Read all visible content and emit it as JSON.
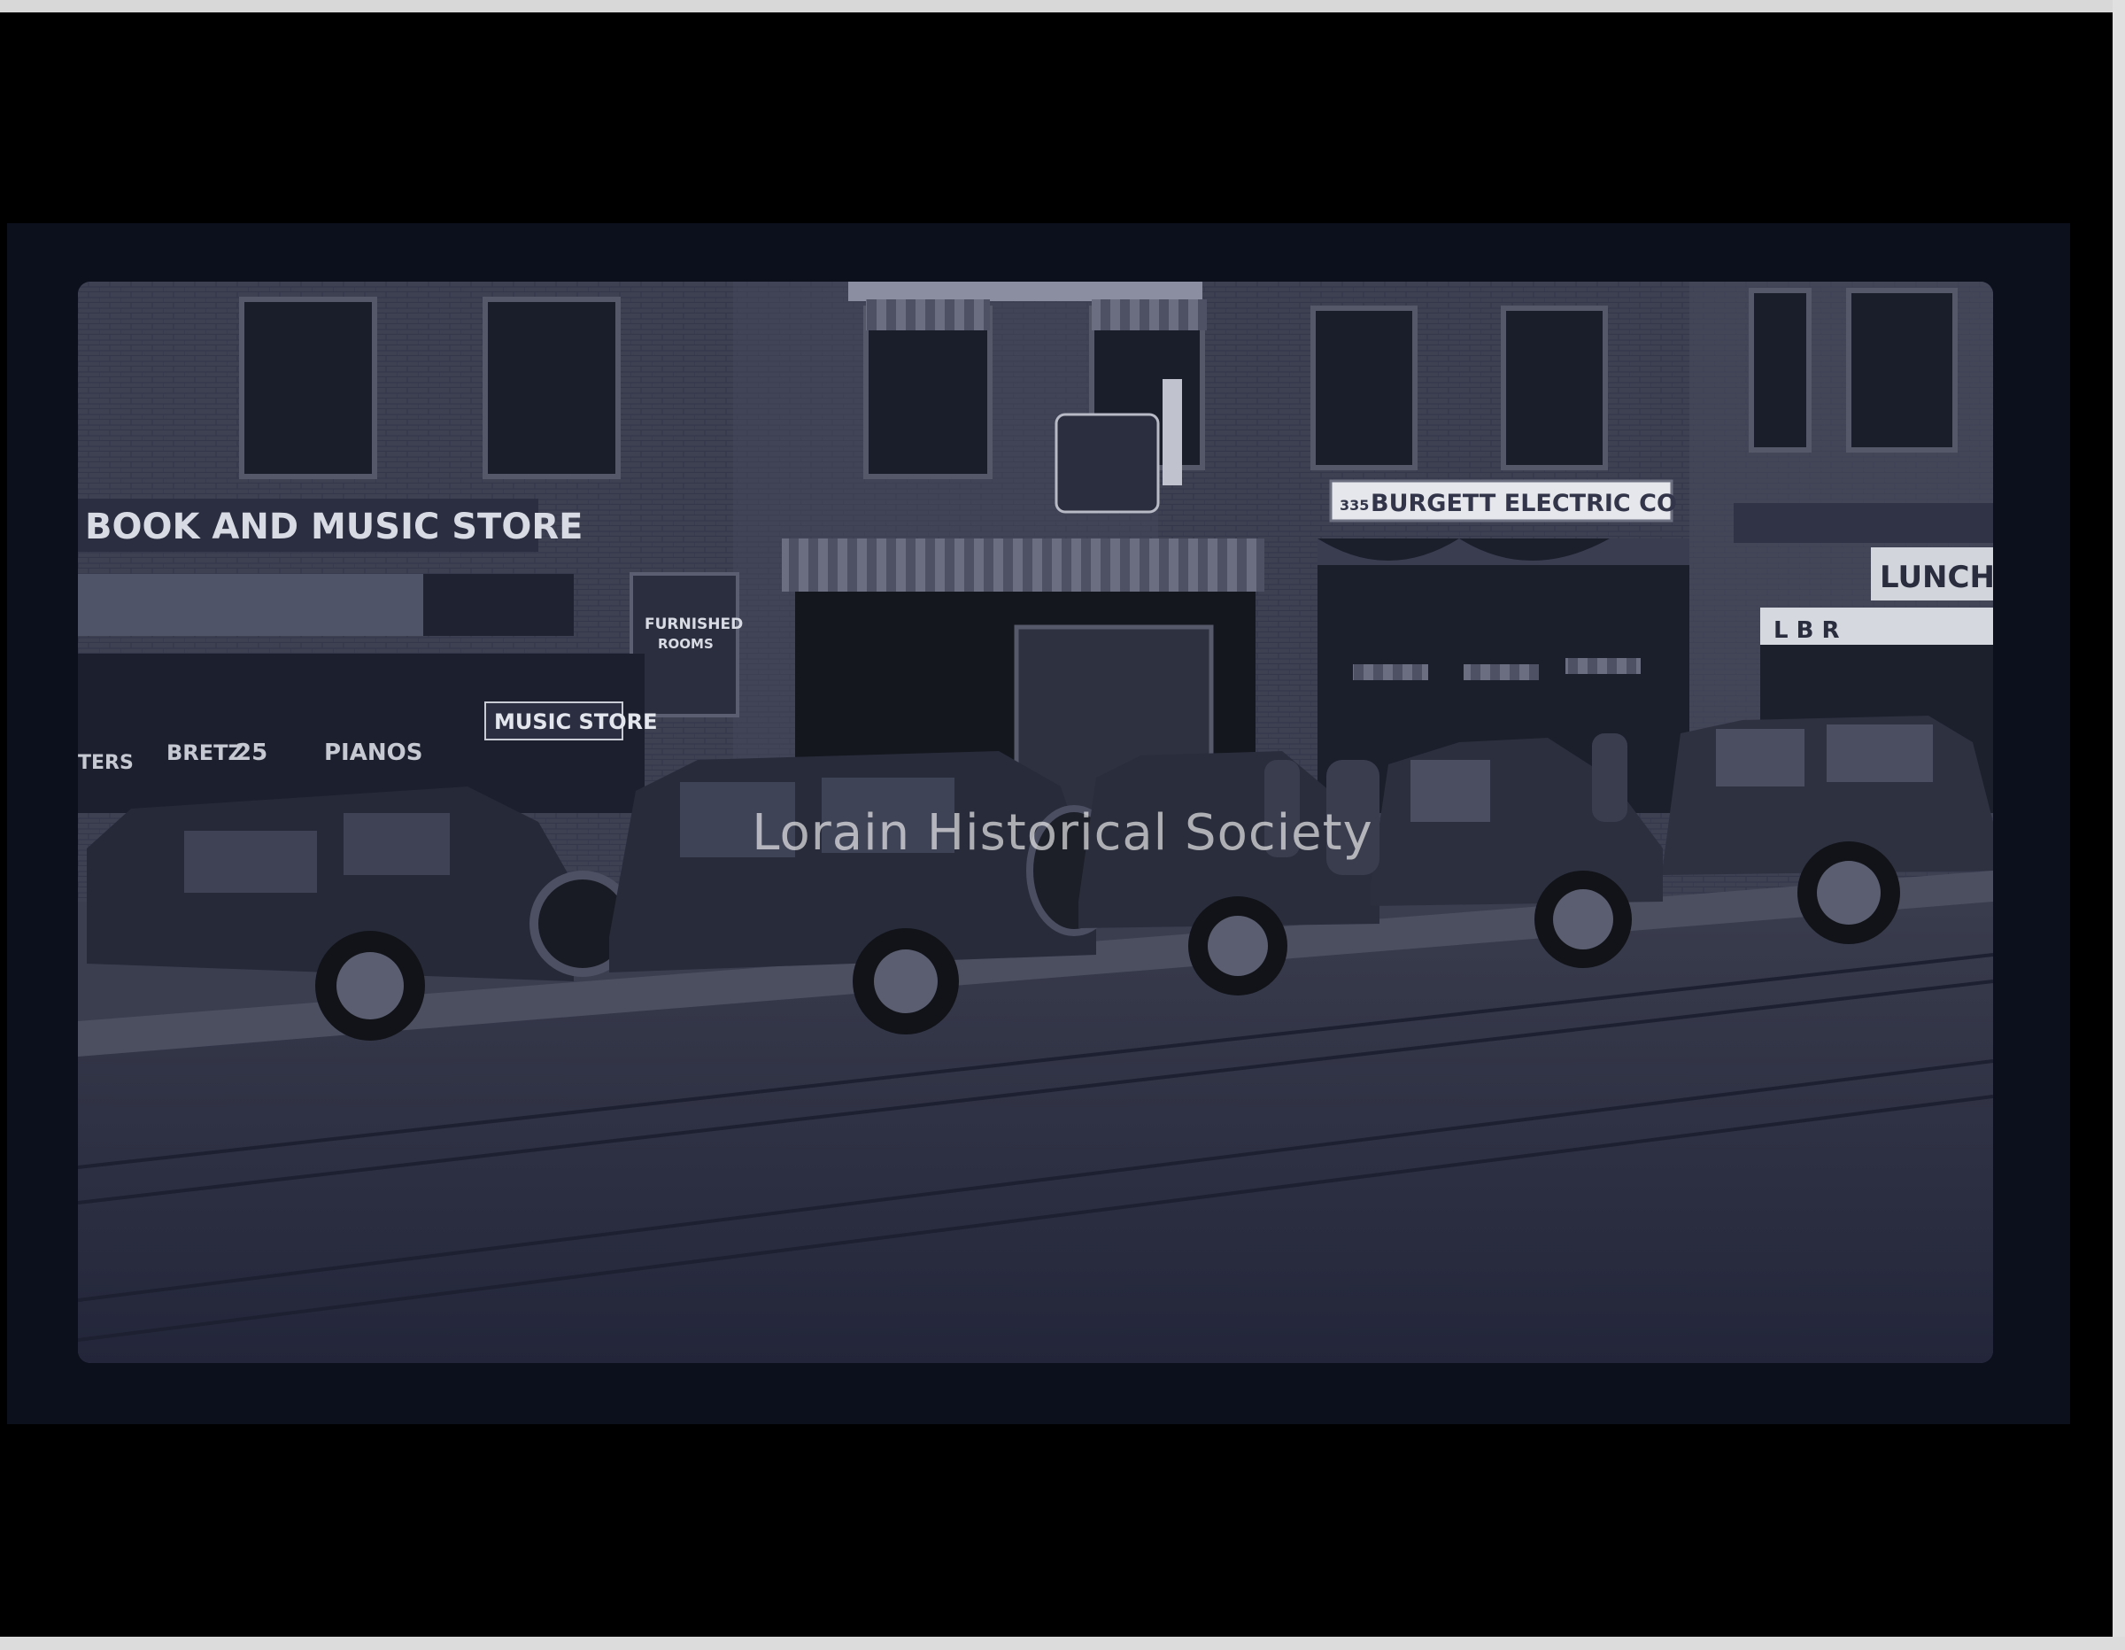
{
  "image": {
    "kind": "scanned film negative",
    "scene": "storefronts with parked vintage cars along a street with streetcar tracks"
  },
  "signs": {
    "book_music": "BOOK AND MUSIC STORE",
    "music_store": "MUSIC STORE",
    "furnished_1": "FURNISHED",
    "furnished_2": "ROOMS",
    "pianos": "PIANOS",
    "bretz": "BRETZ",
    "number_25": "25",
    "ters": "TERS",
    "burgett_num": "335",
    "burgett": "BURGETT ELECTRIC CO",
    "lunch": "LUNCH B",
    "lbr": "L  B  R"
  },
  "watermark": "Lorain Historical Society",
  "colors": {
    "film_border": "#0c0f1c",
    "brick": "#3e4152",
    "street": "#2d3040",
    "sign_bg": "#2a2e40",
    "sign_text": "#d9dbe4"
  }
}
